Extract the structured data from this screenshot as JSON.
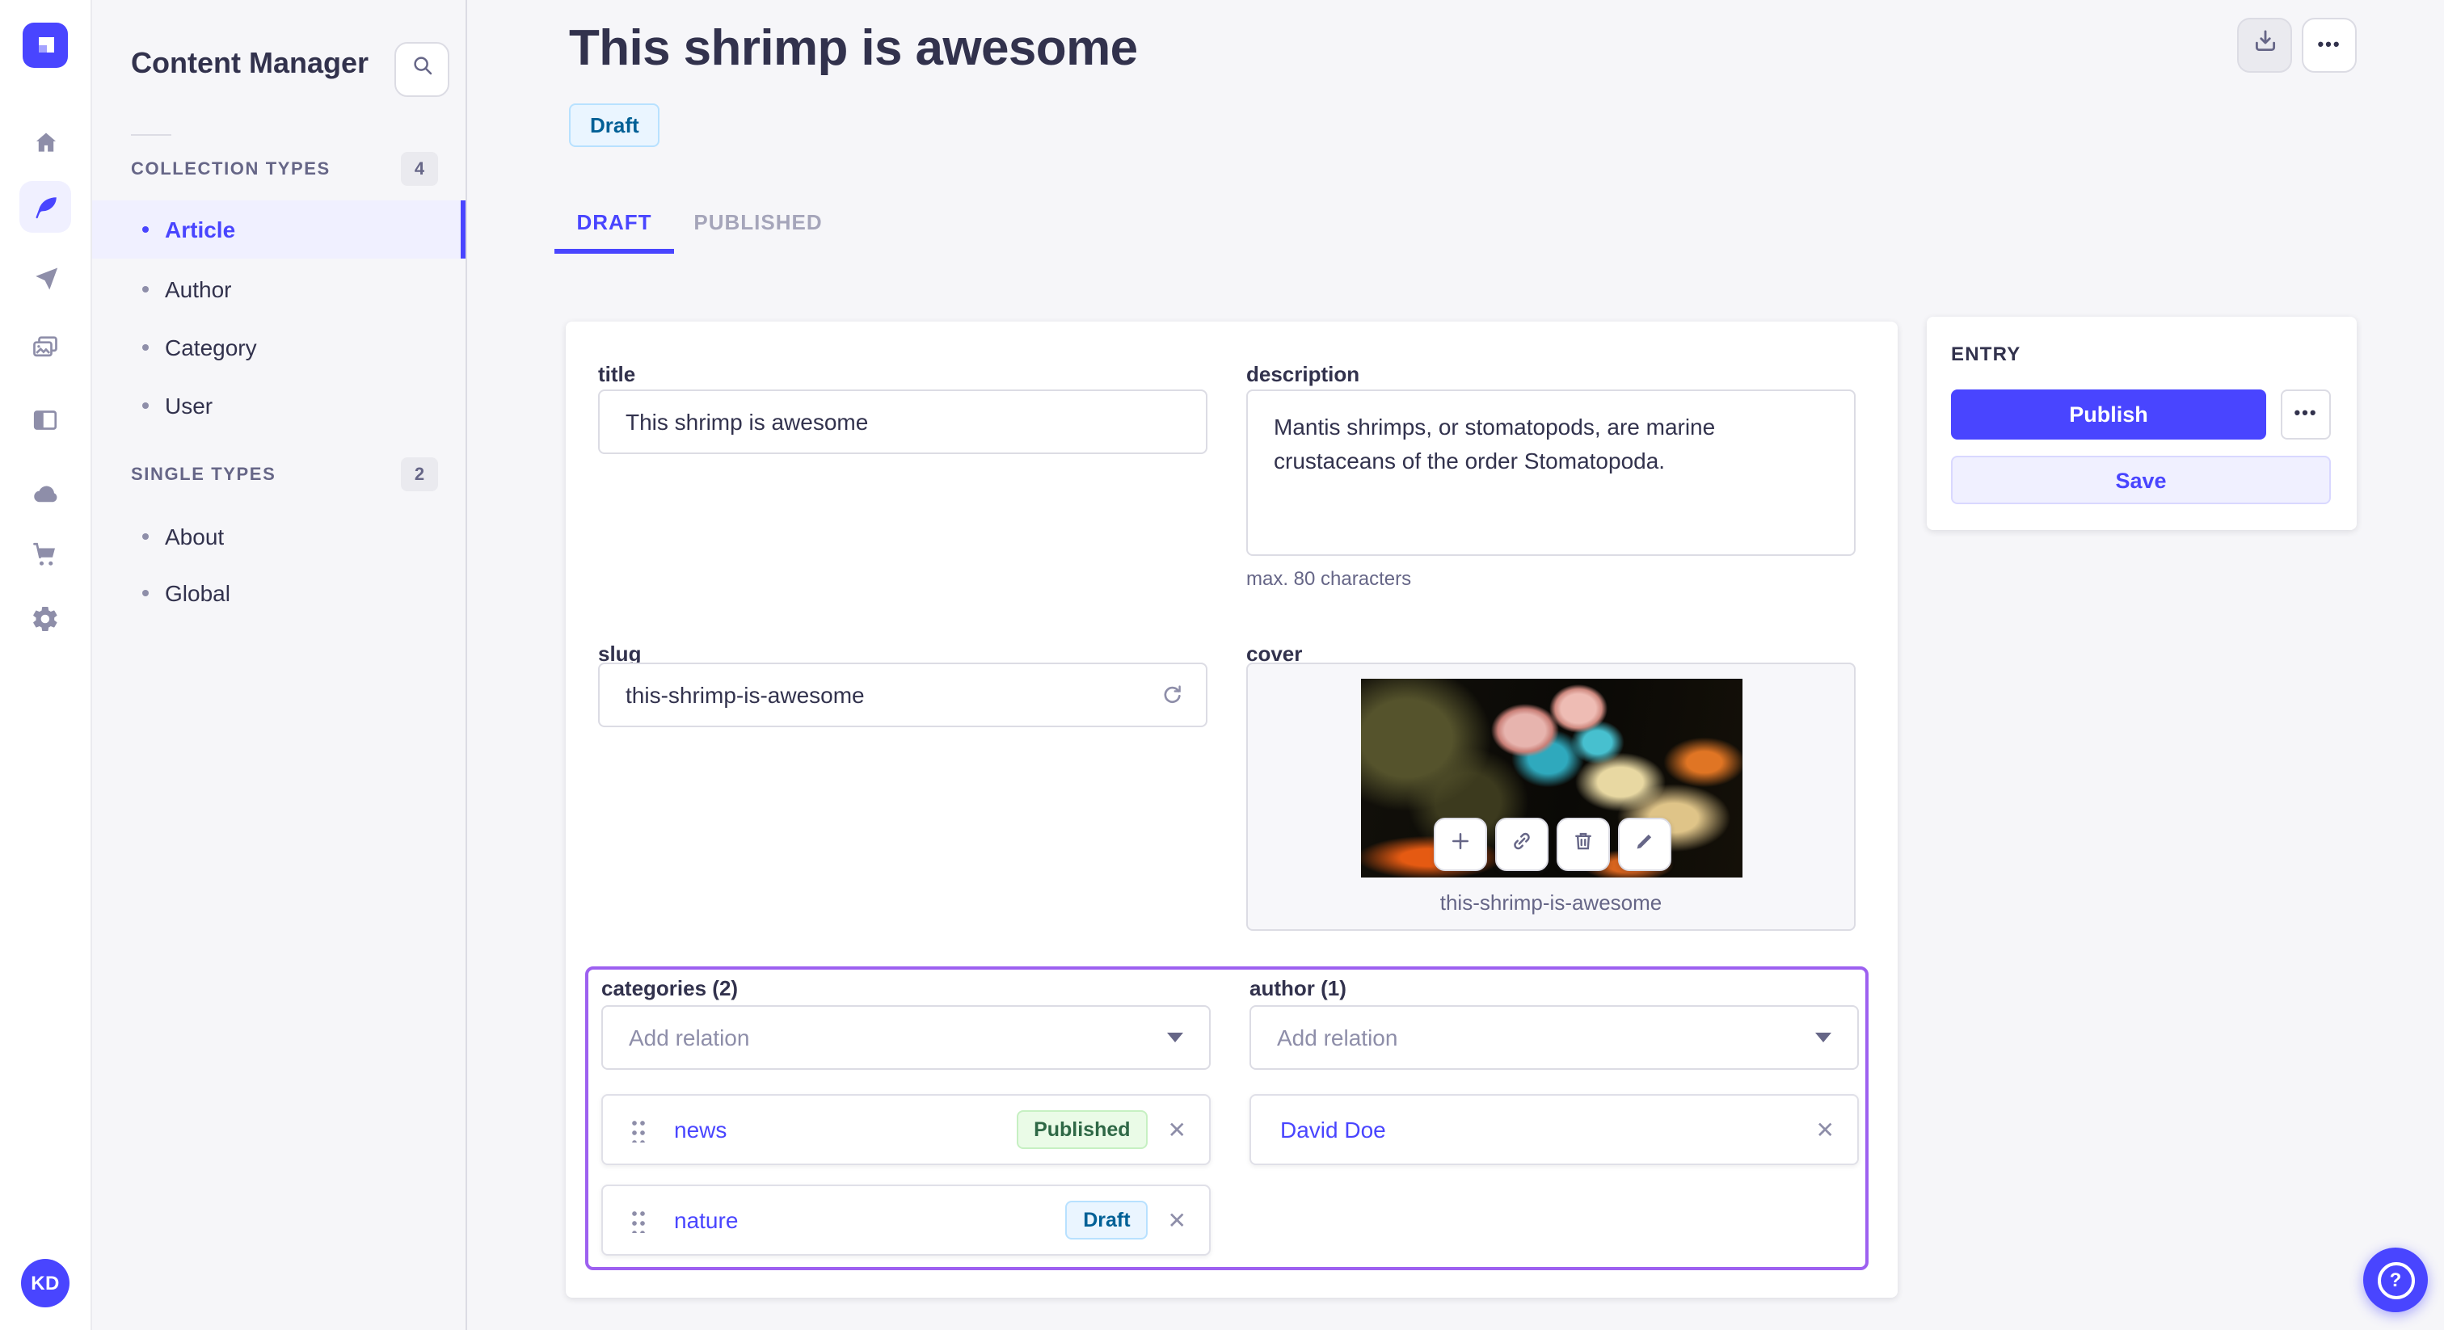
{
  "colors": {
    "primary": "#4945ff",
    "highlight_border": "#9d60f0",
    "draft_badge_bg": "#eaf5ff",
    "draft_badge_text": "#006096",
    "published_badge_bg": "#eafbe7",
    "published_badge_text": "#2f6846",
    "sidebar_bg": "#f6f6f9"
  },
  "icons": {
    "close": "✕",
    "more": "•••",
    "fab": "?"
  },
  "nav_rail": {
    "avatar_initials": "KD",
    "items": [
      "home",
      "content-manager",
      "releases",
      "media-library",
      "content-type-builder",
      "cloud",
      "marketplace",
      "settings"
    ]
  },
  "sidebar": {
    "title": "Content Manager",
    "sections": [
      {
        "label": "COLLECTION TYPES",
        "count": "4",
        "items": [
          {
            "label": "Article",
            "active": true
          },
          {
            "label": "Author"
          },
          {
            "label": "Category"
          },
          {
            "label": "User"
          }
        ]
      },
      {
        "label": "SINGLE TYPES",
        "count": "2",
        "items": [
          {
            "label": "About"
          },
          {
            "label": "Global"
          }
        ]
      }
    ]
  },
  "header": {
    "title": "This shrimp is awesome",
    "status": "Draft",
    "tabs": [
      {
        "label": "DRAFT",
        "active": true
      },
      {
        "label": "PUBLISHED",
        "active": false
      }
    ]
  },
  "form": {
    "title": {
      "label": "title",
      "value": "This shrimp is awesome"
    },
    "description": {
      "label": "description",
      "value": "Mantis shrimps, or stomatopods, are marine crustaceans of the order Stomatopoda.",
      "hint": "max. 80 characters"
    },
    "slug": {
      "label": "slug",
      "value": "this-shrimp-is-awesome"
    },
    "cover": {
      "label": "cover",
      "filename": "this-shrimp-is-awesome"
    },
    "categories": {
      "label": "categories (2)",
      "placeholder": "Add relation",
      "items": [
        {
          "name": "news",
          "status": "Published"
        },
        {
          "name": "nature",
          "status": "Draft"
        }
      ]
    },
    "author": {
      "label": "author (1)",
      "placeholder": "Add relation",
      "items": [
        {
          "name": "David Doe"
        }
      ]
    }
  },
  "entry": {
    "heading": "ENTRY",
    "publish": "Publish",
    "save": "Save"
  }
}
